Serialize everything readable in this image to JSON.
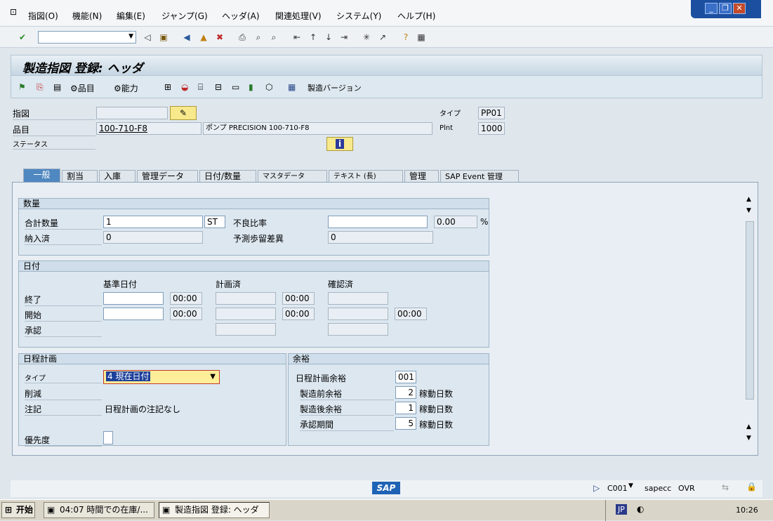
{
  "menu": [
    "指図(O)",
    "機能(N)",
    "編集(E)",
    "ジャンプ(G)",
    "ヘッダ(A)",
    "関連処理(V)",
    "システム(Y)",
    "ヘルプ(H)"
  ],
  "title": "製造指図 登録: ヘッダ",
  "app_toolbar": {
    "material_btn": "品目",
    "capacity_btn": "能力",
    "prod_version_btn": "製造バージョン"
  },
  "header": {
    "order_label": "指図",
    "order_value": "",
    "material_label": "品目",
    "material_value": "100-710-F8",
    "material_desc": "ポンプ PRECISION 100-710-F8",
    "status_label": "ステータス",
    "type_label": "タイプ",
    "type_value": "PP01",
    "plant_label": "Plnt",
    "plant_value": "1000"
  },
  "tabs": [
    "一般",
    "割当",
    "入庫",
    "管理データ",
    "日付/数量",
    "マスタデータ",
    "テキスト (長)",
    "管理",
    "SAP Event 管理"
  ],
  "quantity": {
    "group_title": "数量",
    "total_label": "合計数量",
    "total_value": "1",
    "unit": "ST",
    "scrap_label": "不良比率",
    "scrap_value": "",
    "scrap_pct": "0.00",
    "pct_sign": "%",
    "delivered_label": "納入済",
    "delivered_value": "0",
    "exp_var_label": "予測歩留差異",
    "exp_var_value": "0"
  },
  "dates": {
    "group_title": "日付",
    "col_basic": "基準日付",
    "col_sched": "計画済",
    "col_conf": "確認済",
    "end_label": "終了",
    "start_label": "開始",
    "release_label": "承認",
    "end_basic_time": "00:00",
    "end_sched_time": "00:00",
    "start_basic_time": "00:00",
    "start_sched_time": "00:00",
    "start_conf_time": "00:00"
  },
  "scheduling": {
    "group_title": "日程計画",
    "type_label": "タイプ",
    "type_value": "4 現在日付",
    "reduction_label": "削減",
    "note_label": "注記",
    "note_value": "日程計画の注記なし",
    "priority_label": "優先度",
    "priority_value": ""
  },
  "floats": {
    "group_title": "余裕",
    "sched_margin_label": "日程計画余裕",
    "sched_margin_value": "001",
    "float_before_label": "製造前余裕",
    "float_before_value": "2",
    "float_after_label": "製造後余裕",
    "float_after_value": "1",
    "release_period_label": "承認期間",
    "release_period_value": "5",
    "unit": "稼動日数"
  },
  "statusbar": {
    "system": "C001",
    "server": "sapecc",
    "mode": "OVR"
  },
  "taskbar": {
    "start": "开始",
    "task1": "04:07 時間での在庫/...",
    "task2": "製造指図 登録: ヘッダ",
    "lang": "JP",
    "clock": "10:26"
  },
  "colors": {
    "active_tab": "#4f87c0",
    "window_frame": "#1c4fa0",
    "focus_field": "#ffee99"
  }
}
